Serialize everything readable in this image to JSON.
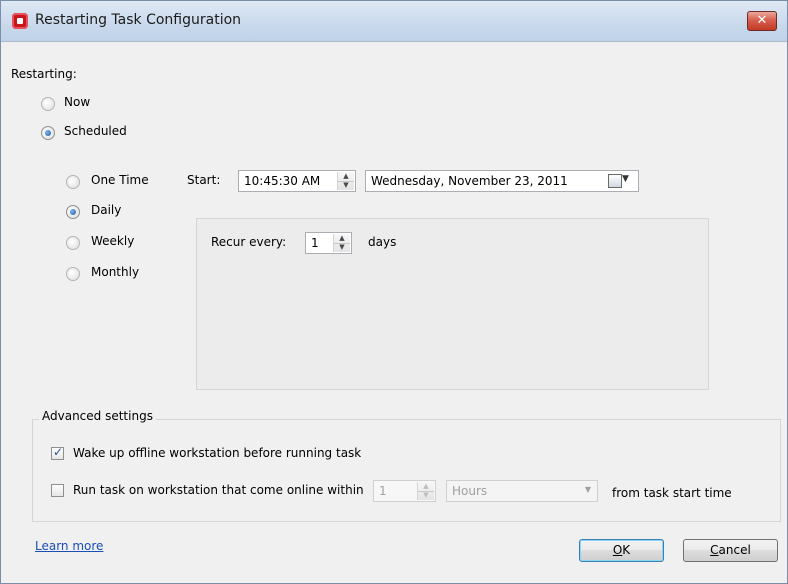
{
  "window": {
    "title": "Restarting Task Configuration",
    "close_symbol": "✕"
  },
  "restarting": {
    "label": "Restarting:",
    "options": [
      "Now",
      "Scheduled"
    ],
    "selected": "Scheduled"
  },
  "schedule": {
    "frequencies": [
      "One Time",
      "Daily",
      "Weekly",
      "Monthly"
    ],
    "selected": "Daily",
    "start_label": "Start:",
    "start_time": "10:45:30 AM",
    "start_date": "Wednesday, November 23, 2011",
    "recur_label": "Recur every:",
    "recur_value": "1",
    "recur_unit": "days"
  },
  "advanced": {
    "legend": "Advanced settings",
    "wake_label": "Wake up offline workstation before running task",
    "wake_checked": true,
    "run_label": "Run task on workstation that come online within",
    "run_checked": false,
    "run_value": "1",
    "run_unit": "Hours",
    "run_suffix": "from task start time"
  },
  "footer": {
    "learn_more": "Learn more",
    "ok_mnemonic": "O",
    "ok_rest": "K",
    "cancel_mnemonic": "C",
    "cancel_rest": "ancel"
  }
}
